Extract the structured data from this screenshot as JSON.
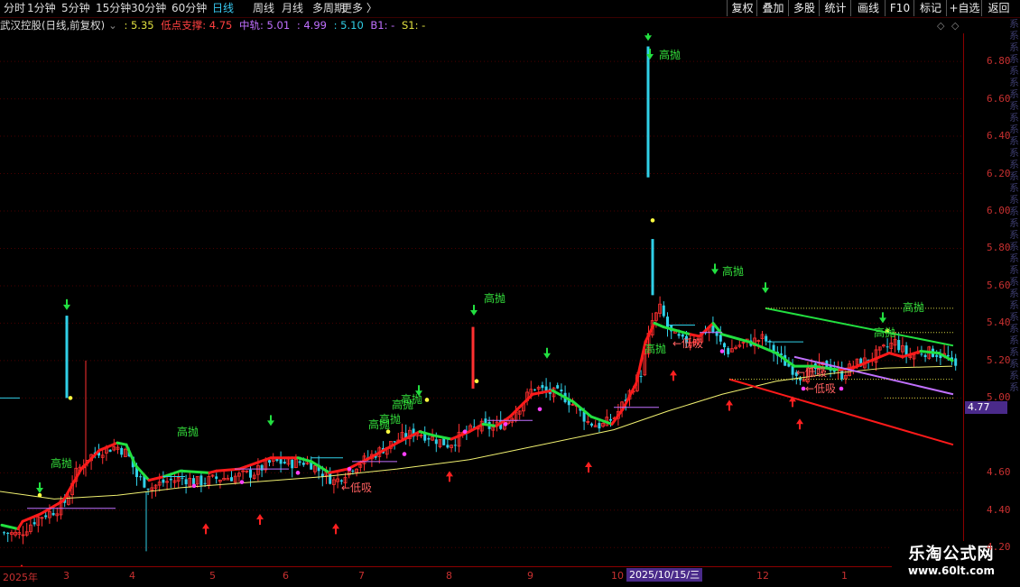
{
  "periods": [
    "分时",
    "1分钟",
    "5分钟",
    "15分钟",
    "30分钟",
    "60分钟",
    "日线",
    "周线",
    "月线",
    "多周期",
    "更多"
  ],
  "active_period": "日线",
  "right_buttons": [
    "复权",
    "叠加",
    "多股",
    "统计",
    "画线",
    "F10",
    "标记",
    "+自选",
    "返回"
  ],
  "info": {
    "title": "武汉控股(日线,前复权)",
    "ind1_value": ": 5.35",
    "support_label": "低点支撑: 4.75",
    "mid_label": "中轨: 5.01",
    "mid_v2": ": 4.99",
    "mid_v3": ": 5.10",
    "b1": "B1: -",
    "s1": "S1: -"
  },
  "y_axis": {
    "ticks": [
      "6.80",
      "6.60",
      "6.40",
      "6.20",
      "6.00",
      "5.80",
      "5.60",
      "5.40",
      "5.20",
      "5.00",
      "4.60",
      "4.40",
      "4.20"
    ],
    "range": [
      4.1,
      6.95
    ]
  },
  "current_price": "4.77",
  "x_axis": {
    "labels": [
      "2025年",
      "3",
      "4",
      "5",
      "6",
      "7",
      "8",
      "9",
      "10",
      "12",
      "1"
    ],
    "cursor_date": "2025/10/15/三"
  },
  "signals": {
    "sell": "高抛",
    "buy": "低吸"
  },
  "logo": {
    "line1": "乐淘公式网",
    "line2": "www.60lt.com"
  },
  "colors": {
    "up": "#ff3030",
    "down": "#30d0e8",
    "ma_yellow": "#f0f070",
    "trend_red": "#ff1a1a",
    "trend_green": "#22e040",
    "purple": "#c070ff",
    "axis_red": "#c83030"
  }
}
